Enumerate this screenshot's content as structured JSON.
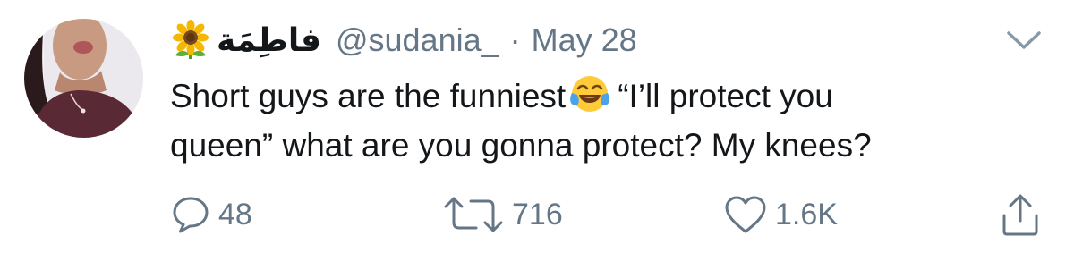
{
  "tweet": {
    "display_name": "فاطِمَة",
    "handle": "@sudania_",
    "separator": "·",
    "date": "May 28",
    "body_line1_before_emoji": "Short guys are the funniest",
    "body_line1_after_emoji": "“I’ll protect you",
    "body_line2": "queen” what are you gonna protect? My knees?",
    "emoji_name": "face-with-tears-of-joy-icon",
    "name_emoji_name": "sunflower-icon"
  },
  "actions": {
    "reply_count": "48",
    "retweet_count": "716",
    "like_count": "1.6K"
  },
  "colors": {
    "text": "#14171a",
    "secondary": "#657786",
    "background": "#ffffff"
  }
}
